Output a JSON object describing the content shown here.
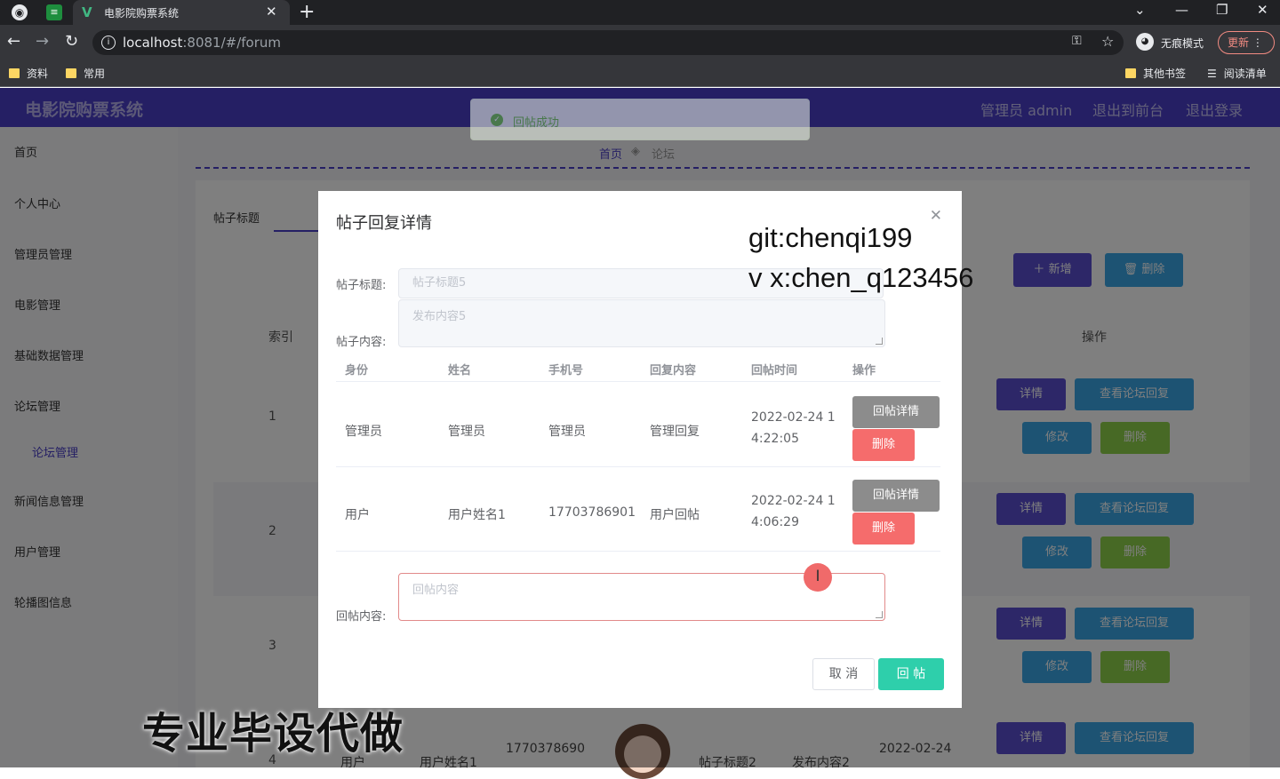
{
  "browser": {
    "tab_title": "电影院购票系统",
    "url_host": "localhost",
    "url_rest": ":8081/#/forum",
    "incognito_label": "无痕模式",
    "update_label": "更新",
    "bookmarks": [
      "资料",
      "常用"
    ],
    "bookmarks_right": [
      "其他书签",
      "阅读清单"
    ]
  },
  "header": {
    "brand": "电影院购票系统",
    "user": "管理员 admin",
    "back_front": "退出到前台",
    "logout": "退出登录"
  },
  "sidebar": {
    "items": [
      "首页",
      "个人中心",
      "管理员管理",
      "电影管理",
      "基础数据管理",
      "论坛管理",
      "新闻信息管理",
      "用户管理",
      "轮播图信息"
    ],
    "sub_item": "论坛管理"
  },
  "breadcrumb": {
    "home": "首页",
    "current": "论坛"
  },
  "list": {
    "search_label": "帖子标题",
    "add_button": "新增",
    "delete_button": "删除",
    "col_index": "索引",
    "col_ops": "操作",
    "rows": [
      "1",
      "2",
      "3",
      "4"
    ],
    "btn_detail": "详情",
    "btn_view_replies": "查看论坛回复",
    "btn_edit": "修改",
    "btn_delete": "删除",
    "bottom_row": {
      "identity": "用户",
      "name": "用户姓名1",
      "phone": "1770378690",
      "title": "帖子标题2",
      "content": "发布内容2",
      "time": "2022-02-24"
    }
  },
  "toast": {
    "message": "回帖成功"
  },
  "dialog": {
    "title": "帖子回复详情",
    "post_title_label": "帖子标题:",
    "post_title_value": "帖子标题5",
    "post_content_label": "帖子内容:",
    "post_content_value": "发布内容5",
    "columns": [
      "身份",
      "姓名",
      "手机号",
      "回复内容",
      "回帖时间",
      "操作"
    ],
    "replies": [
      {
        "identity": "管理员",
        "name": "管理员",
        "phone": "管理员",
        "content": "管理回复",
        "time_line1": "2022-02-24 1",
        "time_line2": "4:22:05"
      },
      {
        "identity": "用户",
        "name": "用户姓名1",
        "phone": "17703786901",
        "content": "用户回帖",
        "time_line1": "2022-02-24 1",
        "time_line2": "4:06:29"
      }
    ],
    "btn_reply_detail": "回帖详情",
    "btn_delete": "删除",
    "reply_label": "回帖内容:",
    "reply_placeholder": "回帖内容",
    "cancel": "取 消",
    "submit": "回 帖"
  },
  "overlays": {
    "watermark_line1": "git:chenqi199",
    "watermark_line2": "v x:chen_q123456",
    "promo": "专业毕设代做"
  }
}
